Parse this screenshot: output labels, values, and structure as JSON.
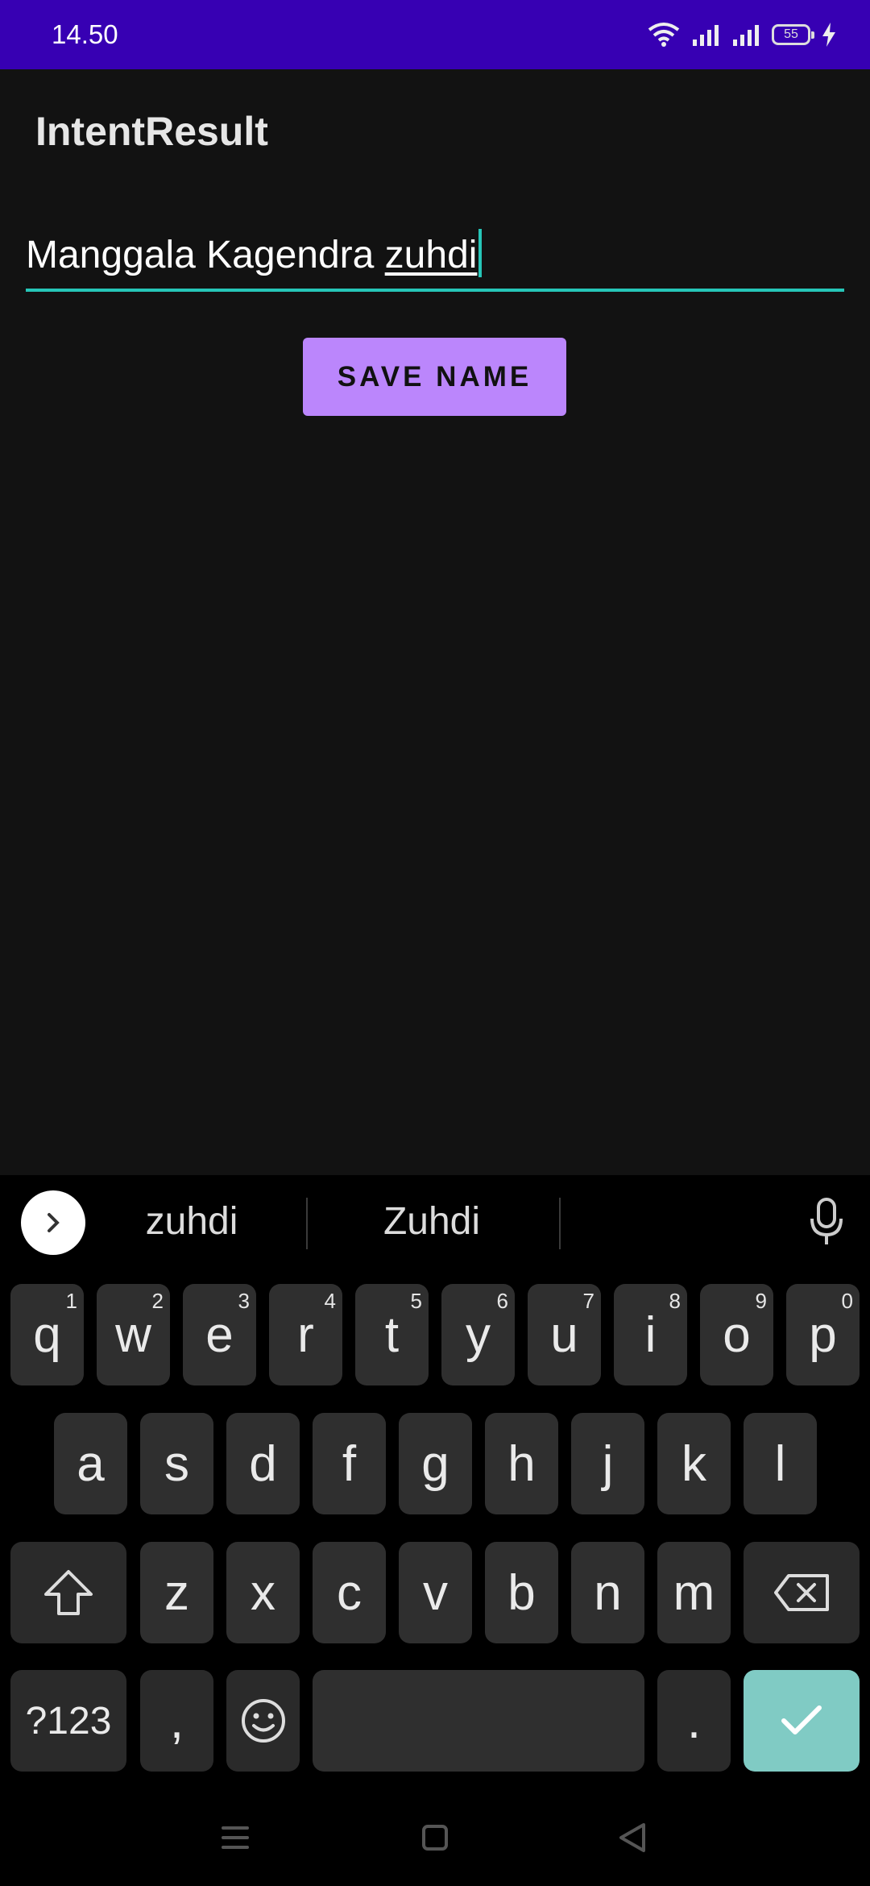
{
  "status": {
    "time": "14.50",
    "battery": "55"
  },
  "app": {
    "title": "IntentResult"
  },
  "input": {
    "prefix": "Manggala Kagendra ",
    "composing": "zuhdi"
  },
  "button": {
    "label": "SAVE NAME"
  },
  "keyboard": {
    "suggestions": [
      "zuhdi",
      "Zuhdi"
    ],
    "row1": [
      {
        "k": "q",
        "n": "1"
      },
      {
        "k": "w",
        "n": "2"
      },
      {
        "k": "e",
        "n": "3"
      },
      {
        "k": "r",
        "n": "4"
      },
      {
        "k": "t",
        "n": "5"
      },
      {
        "k": "y",
        "n": "6"
      },
      {
        "k": "u",
        "n": "7"
      },
      {
        "k": "i",
        "n": "8"
      },
      {
        "k": "o",
        "n": "9"
      },
      {
        "k": "p",
        "n": "0"
      }
    ],
    "row2": [
      "a",
      "s",
      "d",
      "f",
      "g",
      "h",
      "j",
      "k",
      "l"
    ],
    "row3": [
      "z",
      "x",
      "c",
      "v",
      "b",
      "n",
      "m"
    ],
    "symbols_key": "?123",
    "comma_key": ",",
    "period_key": "."
  },
  "colors": {
    "status_bar": "#3700b3",
    "background": "#121212",
    "accent": "#26c6b8",
    "button": "#bb86fc",
    "enter_key": "#80cbc4"
  },
  "icons": [
    "wifi-icon",
    "signal-icon",
    "battery-icon",
    "charging-icon",
    "chevron-right-icon",
    "mic-icon",
    "shift-icon",
    "backspace-icon",
    "emoji-icon",
    "check-icon",
    "menu-icon",
    "home-icon",
    "back-icon"
  ]
}
